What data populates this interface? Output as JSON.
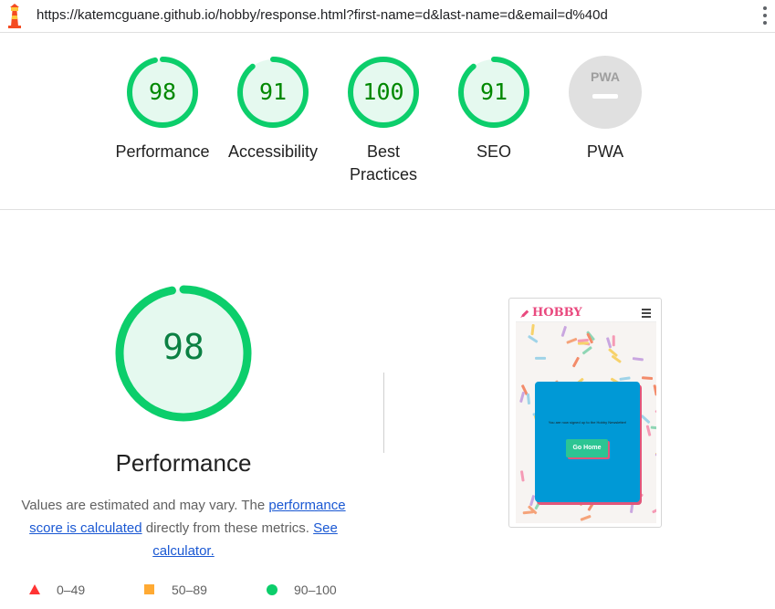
{
  "browser": {
    "url": "https://katemcguane.github.io/hobby/response.html?first-name=d&last-name=d&email=d%40d",
    "logo_icon": "lighthouse-icon",
    "menu_icon": "kebab-menu-icon"
  },
  "scores": [
    {
      "id": "performance",
      "value": "98",
      "fraction": 0.98,
      "label": "Performance"
    },
    {
      "id": "accessibility",
      "value": "91",
      "fraction": 0.91,
      "label": "Accessibility"
    },
    {
      "id": "best-practices",
      "value": "100",
      "fraction": 1.0,
      "label": "Best Practices"
    },
    {
      "id": "seo",
      "value": "91",
      "fraction": 0.91,
      "label": "SEO"
    },
    {
      "id": "pwa",
      "value": "",
      "badge": "PWA",
      "label": "PWA"
    }
  ],
  "detail": {
    "score": "98",
    "fraction": 0.98,
    "title": "Performance",
    "desc_prefix": "Values are estimated and may vary. The ",
    "desc_link": "performance score is calculated",
    "desc_middle": " directly from these metrics. ",
    "desc_link2": "See calculator."
  },
  "legend": [
    {
      "range": "0–49",
      "shape": "triangle",
      "color": "#ff3333"
    },
    {
      "range": "50–89",
      "shape": "square",
      "color": "#ffaa33"
    },
    {
      "range": "90–100",
      "shape": "circle",
      "color": "#0cce6b"
    }
  ],
  "screenshot": {
    "brand": "HOBBY",
    "brand_icon": "paintbrush-icon",
    "menu_icon": "hamburger-icon",
    "message": "You are now signed up to the Hobby Newsletter!",
    "button": "Go Home"
  },
  "colors": {
    "pass": "#0cce6b",
    "pass_fill": "#e5f9ef",
    "pass_text": "#008800",
    "gray": "#e0e0e0"
  }
}
